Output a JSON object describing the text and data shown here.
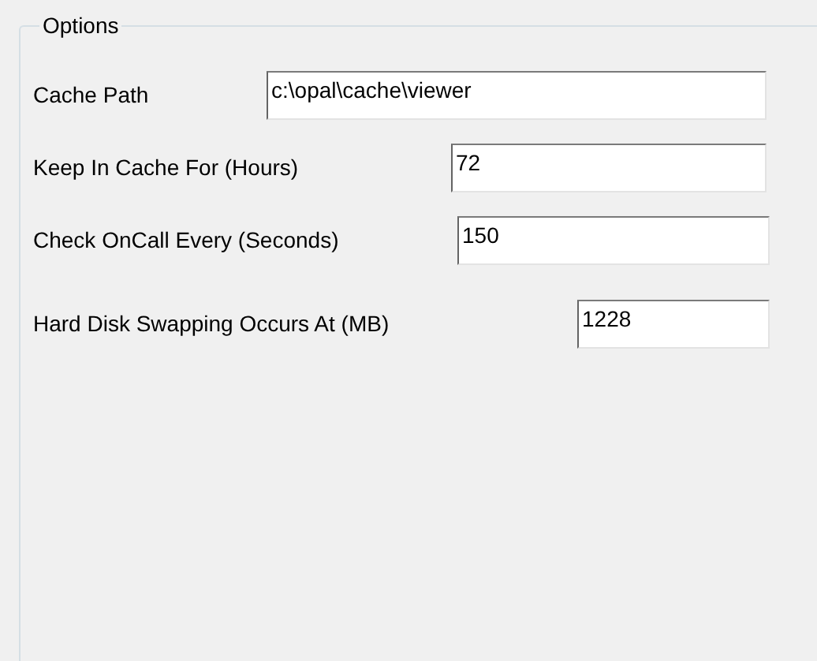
{
  "group": {
    "title": "Options"
  },
  "fields": [
    {
      "label": "Cache Path",
      "value": "c:\\opal\\cache\\viewer"
    },
    {
      "label": "Keep In Cache For (Hours)",
      "value": "72"
    },
    {
      "label": "Check OnCall Every (Seconds)",
      "value": "150"
    },
    {
      "label": "Hard Disk Swapping Occurs At (MB)",
      "value": "1228"
    }
  ]
}
